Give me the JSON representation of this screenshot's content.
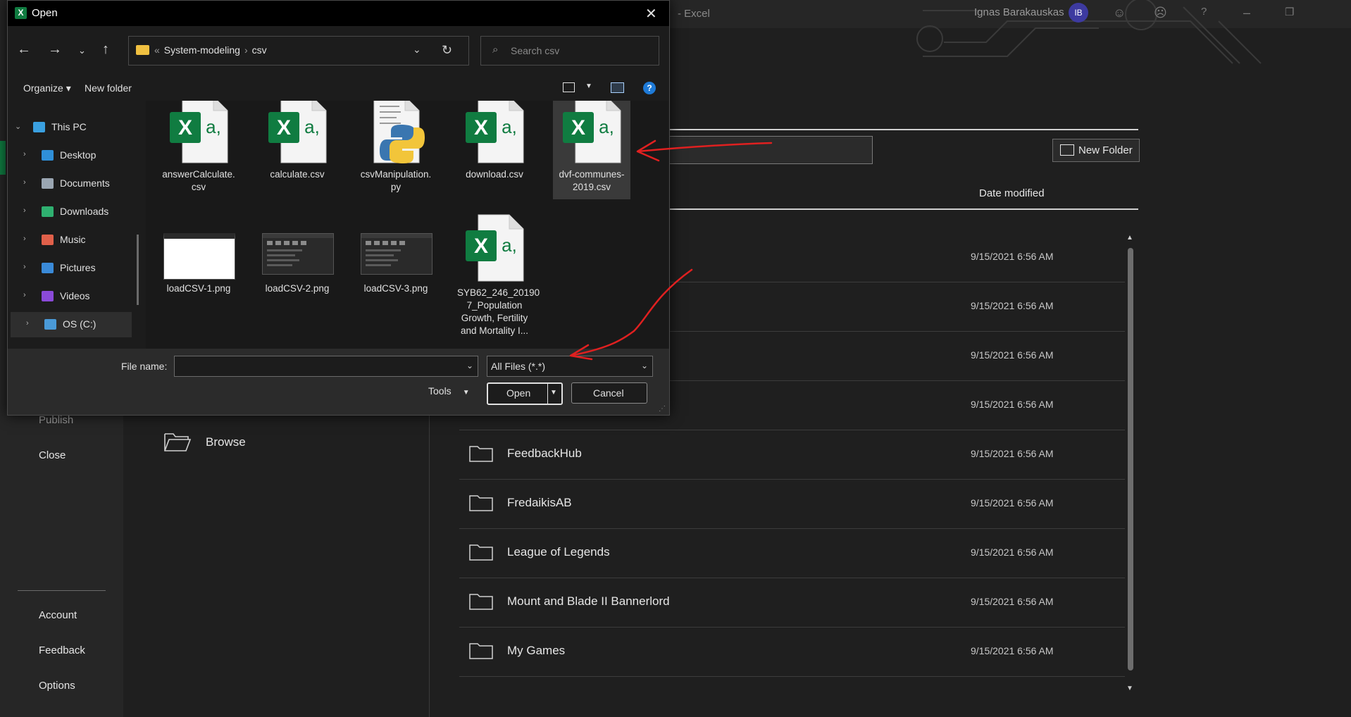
{
  "excel": {
    "doc_title": "-  Excel",
    "user_name": "Ignas Barakauskas",
    "user_initials": "IB",
    "help_glyph": "?",
    "nav": {
      "publish": "Publish",
      "close": "Close",
      "account": "Account",
      "feedback": "Feedback",
      "options": "Options"
    },
    "browse_label": "Browse",
    "new_folder_label": "New Folder",
    "date_modified_header": "Date modified",
    "folders": [
      {
        "name": "",
        "date": "9/15/2021 6:56 AM"
      },
      {
        "name": "",
        "date": "9/15/2021 6:56 AM"
      },
      {
        "name": "",
        "date": "9/15/2021 6:56 AM"
      },
      {
        "name": "",
        "date": "9/15/2021 6:56 AM"
      },
      {
        "name": "FeedbackHub",
        "date": "9/15/2021 6:56 AM"
      },
      {
        "name": "FredaikisAB",
        "date": "9/15/2021 6:56 AM"
      },
      {
        "name": "League of Legends",
        "date": "9/15/2021 6:56 AM"
      },
      {
        "name": "Mount and Blade II Bannerlord",
        "date": "9/15/2021 6:56 AM"
      },
      {
        "name": "My Games",
        "date": "9/15/2021 6:56 AM"
      }
    ]
  },
  "dialog": {
    "title": "Open",
    "app_icon_letter": "X",
    "close_glyph": "✕",
    "breadcrumb": {
      "prefix": "«",
      "parent": "System-modeling",
      "separator": "›",
      "current": "csv"
    },
    "search_placeholder": "Search csv",
    "toolbar": {
      "organize": "Organize ▾",
      "new_folder": "New folder",
      "help": "?"
    },
    "tree": [
      {
        "label": "This PC",
        "icon_color": "#3aa0e0",
        "expanded": true
      },
      {
        "label": "Desktop",
        "icon_color": "#2f8fd8"
      },
      {
        "label": "Documents",
        "icon_color": "#9aa6b2"
      },
      {
        "label": "Downloads",
        "icon_color": "#2fb070"
      },
      {
        "label": "Music",
        "icon_color": "#e0604a"
      },
      {
        "label": "Pictures",
        "icon_color": "#3a8ad8"
      },
      {
        "label": "Videos",
        "icon_color": "#8a4ad8"
      },
      {
        "label": "OS (C:)",
        "icon_color": "#4a9ad8",
        "selected": true
      }
    ],
    "files": [
      {
        "name": "answerCalculate.\ncsv",
        "kind": "xlsx"
      },
      {
        "name": "calculate.csv",
        "kind": "xlsx"
      },
      {
        "name": "csvManipulation.\npy",
        "kind": "py"
      },
      {
        "name": "download.csv",
        "kind": "xlsx"
      },
      {
        "name": "dvf-communes-\n2019.csv",
        "kind": "xlsx",
        "selected": true
      },
      {
        "name": "loadCSV-1.png",
        "kind": "png-white"
      },
      {
        "name": "loadCSV-2.png",
        "kind": "png-dark"
      },
      {
        "name": "loadCSV-3.png",
        "kind": "png-dark"
      },
      {
        "name": "SYB62_246_20190\n7_Population\nGrowth, Fertility\nand Mortality I...",
        "kind": "xlsx"
      }
    ],
    "file_name_label": "File name:",
    "file_name_value": "",
    "filter_value": "All Files (*.*)",
    "tools_label": "Tools",
    "open_label": "Open",
    "cancel_label": "Cancel"
  },
  "colors": {
    "excel_green": "#107c41",
    "annotation_red": "#e02020"
  }
}
